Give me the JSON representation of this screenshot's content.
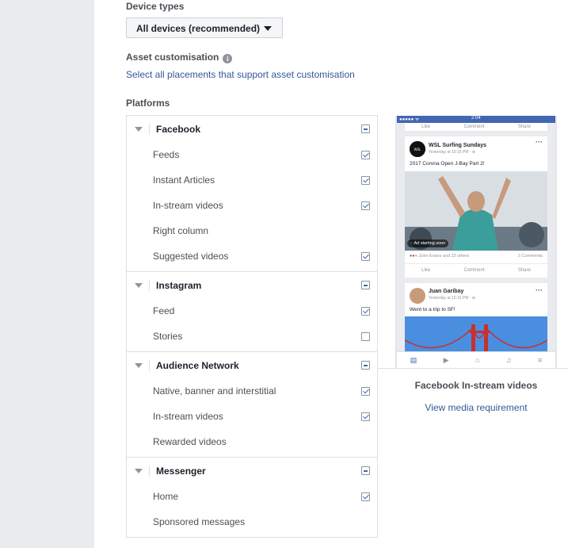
{
  "device_types": {
    "label": "Device types",
    "selected": "All devices (recommended)"
  },
  "asset_customisation": {
    "label": "Asset customisation",
    "link": "Select all placements that support asset customisation"
  },
  "platforms": {
    "label": "Platforms",
    "groups": [
      {
        "title": "Facebook",
        "state": "partial",
        "items": [
          {
            "label": "Feeds",
            "checked": true
          },
          {
            "label": "Instant Articles",
            "checked": true
          },
          {
            "label": "In-stream videos",
            "checked": true
          },
          {
            "label": "Right column",
            "checked": false,
            "unavailable": true
          },
          {
            "label": "Suggested videos",
            "checked": true
          }
        ]
      },
      {
        "title": "Instagram",
        "state": "partial",
        "items": [
          {
            "label": "Feed",
            "checked": true
          },
          {
            "label": "Stories",
            "checked": false
          }
        ]
      },
      {
        "title": "Audience Network",
        "state": "partial",
        "items": [
          {
            "label": "Native, banner and interstitial",
            "checked": true
          },
          {
            "label": "In-stream videos",
            "checked": true
          },
          {
            "label": "Rewarded videos",
            "checked": false,
            "unavailable": true
          }
        ]
      },
      {
        "title": "Messenger",
        "state": "partial",
        "items": [
          {
            "label": "Home",
            "checked": true
          },
          {
            "label": "Sponsored messages",
            "checked": false,
            "unavailable": true
          }
        ]
      }
    ]
  },
  "preview": {
    "caption": "Facebook In-stream videos",
    "link": "View media requirement",
    "phone": {
      "time": "2:04",
      "carrier": "●●●●● ᯤ",
      "actions": [
        "Like",
        "Comment",
        "Share"
      ],
      "post1": {
        "author": "WSL Surfing Sundays",
        "time": "Yesterday at 10:16 PM · ⊕",
        "text": "2017 Corona Open J-Bay Part 2!",
        "ad_badge": "Ad starting soon",
        "reactions": "John Evans and 23 others",
        "comments": "2 Comments"
      },
      "post2": {
        "author": "Juan Garibay",
        "time": "Yesterday at 10:16 PM · ⊕",
        "text": "Went to a trip to SF!"
      },
      "nav_icons": [
        "news-feed-icon",
        "watch-icon",
        "marketplace-icon",
        "notifications-icon",
        "menu-icon"
      ]
    }
  },
  "colors": {
    "link": "#365899",
    "check": "#4267b2",
    "sidebar": "#e9ebee",
    "fb_blue": "#4267b2"
  }
}
